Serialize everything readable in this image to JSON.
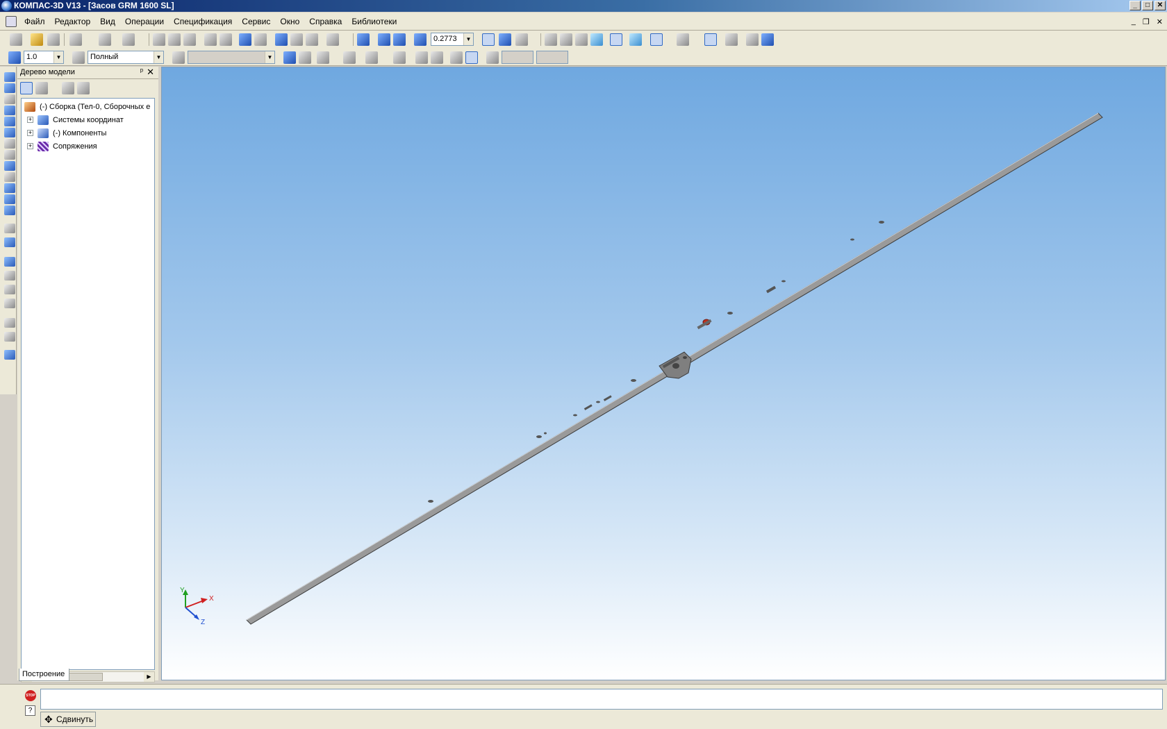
{
  "window": {
    "title": "КОМПАС-3D V13 - [Засов GRM 1600 SL]",
    "buttons": {
      "minimize": "_",
      "maximize": "□",
      "close": "✕"
    }
  },
  "menu": {
    "items": [
      "Файл",
      "Редактор",
      "Вид",
      "Операции",
      "Спецификация",
      "Сервис",
      "Окно",
      "Справка",
      "Библиотеки"
    ],
    "mdi_buttons": {
      "minimize": "_",
      "restore": "❐",
      "close": "✕"
    }
  },
  "toolbar": {
    "zoom_value": "0.2773",
    "step_value": "1.0",
    "display_mode": "Полный"
  },
  "tree": {
    "title": "Дерево модели",
    "pin": "ᵖ",
    "close": "✕",
    "items": [
      {
        "label": "(-) Сборка (Тел-0, Сборочных е",
        "icon": "assembly-icon"
      },
      {
        "label": "Системы координат",
        "icon": "coordinate-system-icon"
      },
      {
        "label": "(-) Компоненты",
        "icon": "components-icon"
      },
      {
        "label": "Сопряжения",
        "icon": "mates-icon"
      }
    ],
    "tab": "Построение"
  },
  "viewport": {
    "axes": {
      "x": "X",
      "y": "Y",
      "z": "Z"
    },
    "colors": {
      "part": "#9a9a9a",
      "part_edge": "#3c3c3c",
      "handle": "#c03020"
    }
  },
  "status": {
    "stop": "STOP",
    "help": "?",
    "tab_label": "Сдвинуть"
  }
}
